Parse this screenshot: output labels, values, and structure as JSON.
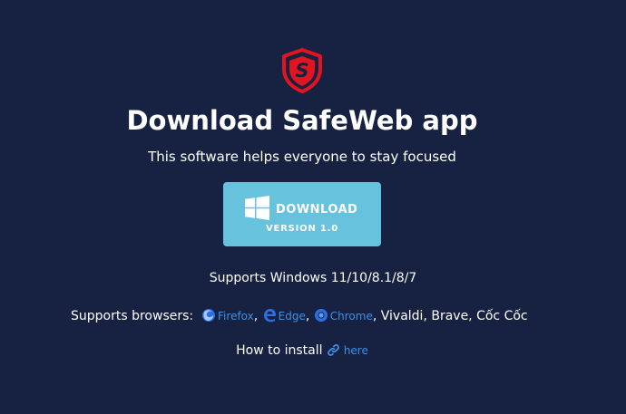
{
  "logo": {
    "icon": "safeweb-shield-icon",
    "letter": "S",
    "color": "#e0151f"
  },
  "header": {
    "title": "Download SafeWeb app",
    "subtitle": "This software helps everyone to stay focused"
  },
  "download_button": {
    "label": "DOWNLOAD",
    "version": "VERSION 1.0",
    "icon": "windows-icon",
    "bg_color": "#67c2de"
  },
  "supports": {
    "windows": "Supports Windows 11/10/8.1/8/7",
    "browsers_label": "Supports browsers:",
    "browsers": [
      {
        "name": "Firefox",
        "icon": "firefox-icon",
        "suffix": ", "
      },
      {
        "name": "Edge",
        "icon": "edge-icon",
        "suffix": ", "
      },
      {
        "name": "Chrome",
        "icon": "chrome-icon",
        "suffix": ", "
      }
    ],
    "other_browsers": "Vivaldi, Brave, Cốc Cốc"
  },
  "install": {
    "label": "How to install",
    "link_icon": "link-icon",
    "link_text": "here"
  },
  "colors": {
    "background": "#172142",
    "link": "#3f8fe6"
  }
}
